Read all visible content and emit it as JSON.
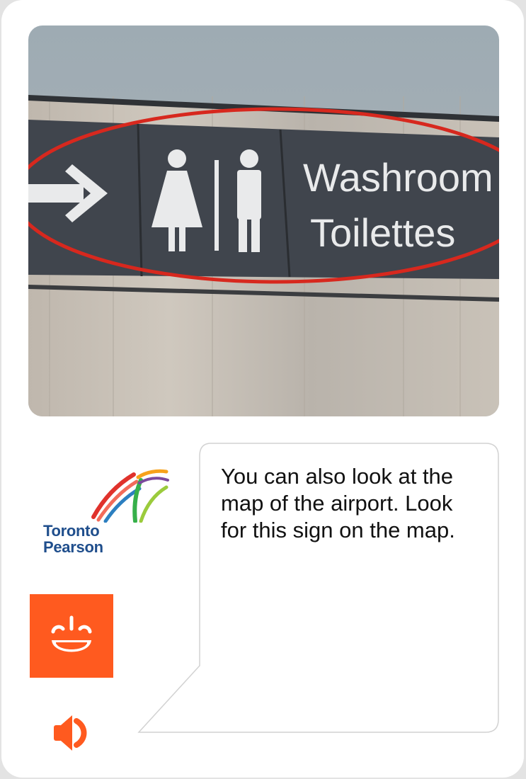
{
  "photo": {
    "sign_line1": "Washroom",
    "sign_line2": "Toilettes",
    "sign_color": "#40454d",
    "highlight_color": "#d7281e"
  },
  "logo": {
    "line1": "Toronto",
    "line2": "Pearson"
  },
  "message": {
    "text": "You can also look at the map of the airport. Look for this sign on the map."
  },
  "icons": {
    "character": "smiling-face-icon",
    "audio": "speaker-icon"
  },
  "colors": {
    "accent": "#ff5a1f",
    "logo_blue": "#1f4e8c"
  }
}
